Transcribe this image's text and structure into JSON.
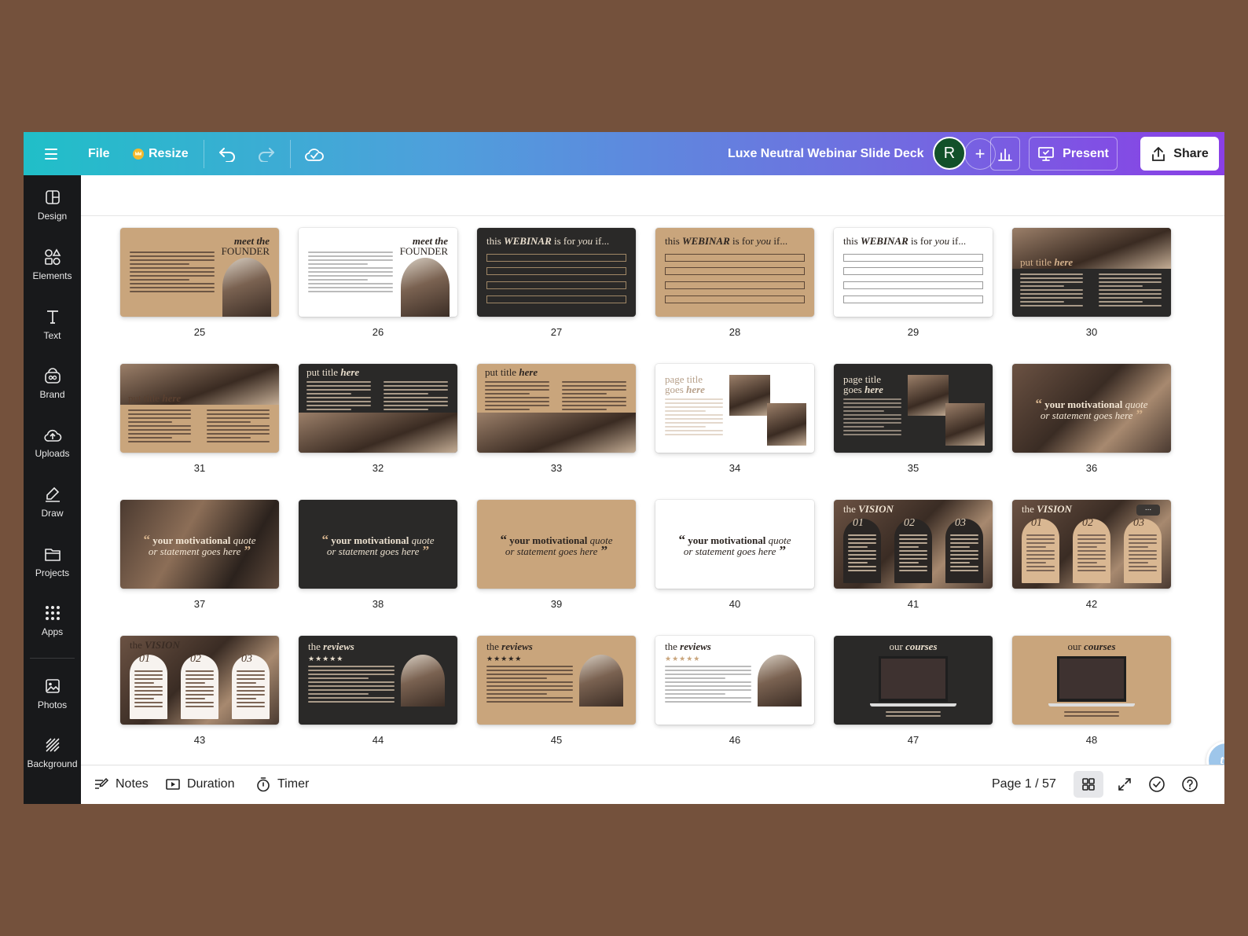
{
  "topbar": {
    "file_label": "File",
    "resize_label": "Resize",
    "doc_title": "Luxe Neutral Webinar Slide Deck",
    "avatar_initial": "R",
    "add_label": "+",
    "present_label": "Present",
    "share_label": "Share"
  },
  "sidebar": {
    "items": [
      {
        "label": "Design",
        "icon": "design-icon"
      },
      {
        "label": "Elements",
        "icon": "elements-icon"
      },
      {
        "label": "Text",
        "icon": "text-icon"
      },
      {
        "label": "Brand",
        "icon": "brand-icon"
      },
      {
        "label": "Uploads",
        "icon": "uploads-icon"
      },
      {
        "label": "Draw",
        "icon": "draw-icon"
      },
      {
        "label": "Projects",
        "icon": "projects-icon"
      },
      {
        "label": "Apps",
        "icon": "apps-icon"
      },
      {
        "label": "Photos",
        "icon": "photos-icon"
      },
      {
        "label": "Background",
        "icon": "background-icon"
      }
    ]
  },
  "slides": [
    {
      "num": "25",
      "kind": "founder",
      "bg": "tan",
      "title_a": "meet the",
      "title_b": "FOUNDER"
    },
    {
      "num": "26",
      "kind": "founder",
      "bg": "white",
      "title_a": "meet the",
      "title_b": "FOUNDER"
    },
    {
      "num": "27",
      "kind": "webinar",
      "bg": "dark",
      "title_a": "this",
      "title_b": "WEBINAR",
      "title_c": "is for",
      "title_d": "you",
      "title_e": "if..."
    },
    {
      "num": "28",
      "kind": "webinar",
      "bg": "tan",
      "title_a": "this",
      "title_b": "WEBINAR",
      "title_c": "is for",
      "title_d": "you",
      "title_e": "if..."
    },
    {
      "num": "29",
      "kind": "webinar",
      "bg": "white",
      "title_a": "this",
      "title_b": "WEBINAR",
      "title_c": "is for",
      "title_d": "you",
      "title_e": "if..."
    },
    {
      "num": "30",
      "kind": "photo-title",
      "bg": "dark",
      "title_a": "put title",
      "title_b": "here"
    },
    {
      "num": "31",
      "kind": "photo-title",
      "bg": "tan",
      "title_a": "put title",
      "title_b": "here"
    },
    {
      "num": "32",
      "kind": "title-photos",
      "bg": "dark",
      "title_a": "put title",
      "title_b": "here"
    },
    {
      "num": "33",
      "kind": "title-photos",
      "bg": "tan",
      "title_a": "put title",
      "title_b": "here"
    },
    {
      "num": "34",
      "kind": "page-title",
      "bg": "white",
      "title_a": "page title",
      "title_b": "goes",
      "title_c": "here"
    },
    {
      "num": "35",
      "kind": "page-title",
      "bg": "dark",
      "title_a": "page title",
      "title_b": "goes",
      "title_c": "here"
    },
    {
      "num": "36",
      "kind": "quote",
      "bg": "photo",
      "title_a": "your motivational",
      "title_b": "quote",
      "title_c": "or statement goes here"
    },
    {
      "num": "37",
      "kind": "quote",
      "bg": "photo2",
      "title_a": "your motivational",
      "title_b": "quote",
      "title_c": "or statement goes here"
    },
    {
      "num": "38",
      "kind": "quote",
      "bg": "dark",
      "title_a": "your motivational",
      "title_b": "quote",
      "title_c": "or statement goes here"
    },
    {
      "num": "39",
      "kind": "quote",
      "bg": "tan",
      "title_a": "your motivational",
      "title_b": "quote",
      "title_c": "or statement goes here"
    },
    {
      "num": "40",
      "kind": "quote",
      "bg": "white",
      "title_a": "your motivational",
      "title_b": "quote",
      "title_c": "or statement goes here"
    },
    {
      "num": "41",
      "kind": "vision",
      "bg": "photo",
      "arch": "dark",
      "title_a": "the",
      "title_b": "VISION",
      "cols": [
        "01",
        "02",
        "03"
      ]
    },
    {
      "num": "42",
      "kind": "vision",
      "bg": "photo",
      "arch": "tan",
      "title_a": "the",
      "title_b": "VISION",
      "cols": [
        "01",
        "02",
        "03"
      ],
      "more": "..."
    },
    {
      "num": "43",
      "kind": "vision",
      "bg": "photo",
      "arch": "white",
      "title_a": "the",
      "title_b": "VISION",
      "cols": [
        "01",
        "02",
        "03"
      ]
    },
    {
      "num": "44",
      "kind": "reviews",
      "bg": "dark",
      "title_a": "the",
      "title_b": "reviews",
      "stars": "★★★★★"
    },
    {
      "num": "45",
      "kind": "reviews",
      "bg": "tan",
      "title_a": "the",
      "title_b": "reviews",
      "stars": "★★★★★"
    },
    {
      "num": "46",
      "kind": "reviews",
      "bg": "white",
      "title_a": "the",
      "title_b": "reviews",
      "stars": "★★★★★"
    },
    {
      "num": "47",
      "kind": "courses",
      "bg": "dark",
      "title_a": "our",
      "title_b": "courses"
    },
    {
      "num": "48",
      "kind": "courses",
      "bg": "tan",
      "title_a": "our",
      "title_b": "courses"
    }
  ],
  "bottombar": {
    "notes_label": "Notes",
    "duration_label": "Duration",
    "timer_label": "Timer",
    "page_indicator": "Page 1 / 57"
  },
  "assistant_bubble": "tw",
  "colors": {
    "gradient_start": "#20bfc8",
    "gradient_end": "#8a3fe6",
    "sidebar_bg": "#18191b",
    "tan": "#c9a57c",
    "dark": "#2a2928",
    "backdrop": "#74513c"
  }
}
